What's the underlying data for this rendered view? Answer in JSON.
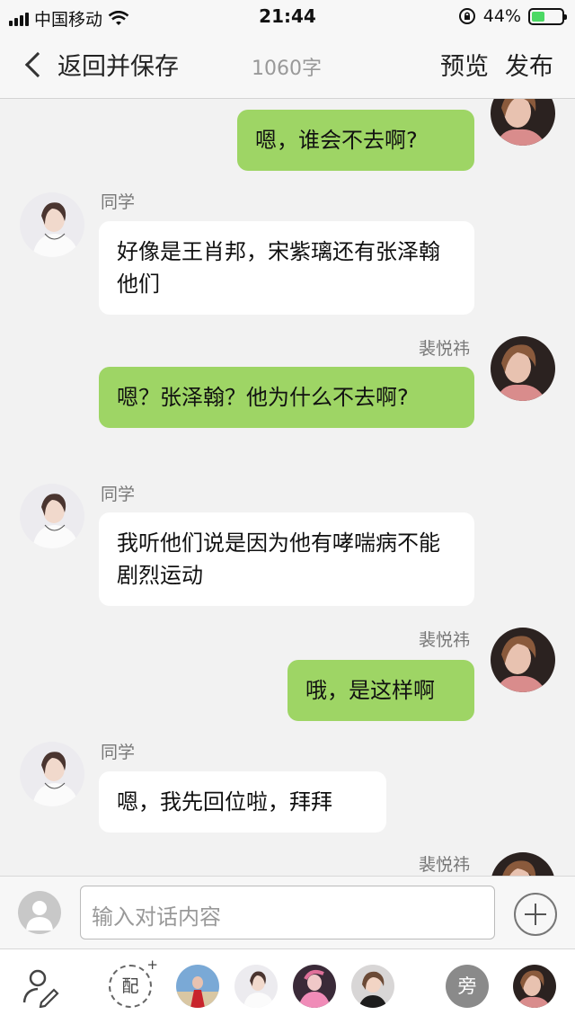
{
  "status_bar": {
    "carrier": "中国移动",
    "time": "21:44",
    "battery_percent": "44%",
    "battery_level": 0.44
  },
  "nav": {
    "back_label": "返回并保存",
    "word_count": "1060字",
    "preview_label": "预览",
    "publish_label": "发布"
  },
  "chat": {
    "messages": [
      {
        "side": "right",
        "sender": "",
        "text": "嗯，谁会不去啊?"
      },
      {
        "side": "left",
        "sender": "同学",
        "text": "好像是王肖邦，宋紫璃还有张泽翰他们"
      },
      {
        "side": "right",
        "sender": "裴悦祎",
        "text": "嗯？张泽翰？他为什么不去啊?"
      },
      {
        "side": "left",
        "sender": "同学",
        "text": "我听他们说是因为他有哮喘病不能剧烈运动"
      },
      {
        "side": "right",
        "sender": "裴悦祎",
        "text": "哦，是这样啊"
      },
      {
        "side": "left",
        "sender": "同学",
        "text": "嗯，我先回位啦，拜拜"
      },
      {
        "side": "right",
        "sender": "裴悦祎",
        "text": ""
      }
    ],
    "bubble_me_color": "#9ed565",
    "bubble_them_color": "#ffffff"
  },
  "input": {
    "placeholder": "输入对话内容",
    "user_icon": "user-icon",
    "add_icon": "plus-icon"
  },
  "character_bar": {
    "edit_icon": "edit-characters-icon",
    "pei_label": "配",
    "pei_plus": "+",
    "narrator_label": "旁"
  },
  "colors": {
    "background": "#f2f2f2",
    "battery_green": "#4cd964"
  }
}
